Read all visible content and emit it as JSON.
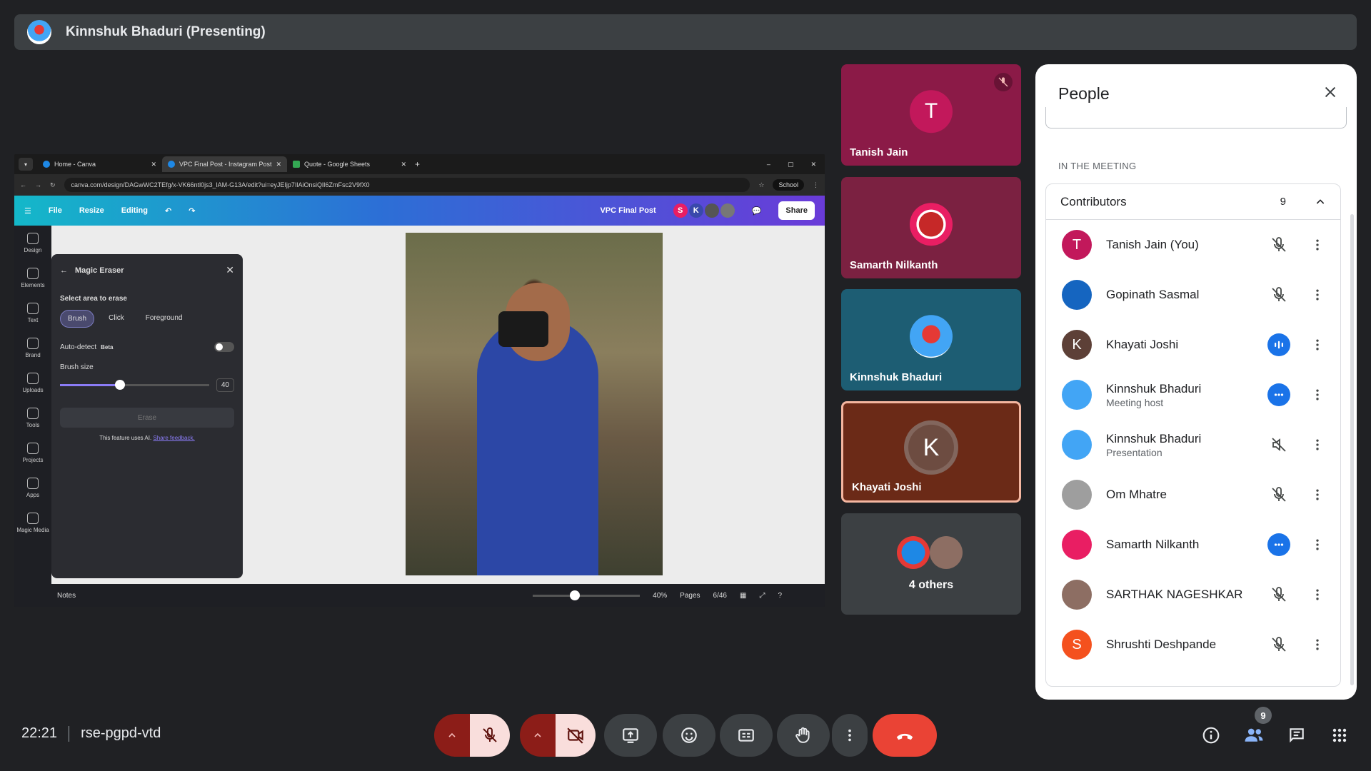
{
  "presenter_bar": {
    "title": "Kinnshuk Bhaduri (Presenting)"
  },
  "shared_screen": {
    "tabs": [
      {
        "label": "Home - Canva"
      },
      {
        "label": "VPC Final Post - Instagram Post"
      },
      {
        "label": "Quote - Google Sheets"
      }
    ],
    "url": "canva.com/design/DAGwWC2TEfg/x-VK66ntl0js3_lAM-G13A/edit?ui=eyJEIjp7IlAiOnsiQlI6ZmFsc2V9fX0",
    "profile_label": "School",
    "canva_menu": {
      "file": "File",
      "resize": "Resize",
      "editing": "Editing"
    },
    "design_title": "VPC Final Post",
    "collab_chips": [
      "S",
      "K"
    ],
    "share_label": "Share",
    "side_rail": [
      "Design",
      "Elements",
      "Text",
      "Brand",
      "Uploads",
      "Tools",
      "Projects",
      "Apps",
      "Magic Media"
    ],
    "magic_eraser": {
      "title": "Magic Eraser",
      "select_label": "Select area to erase",
      "options": [
        "Brush",
        "Click",
        "Foreground"
      ],
      "auto_detect": "Auto-detect",
      "beta": "Beta",
      "brush_size_label": "Brush size",
      "brush_size": "40",
      "brush_fraction": 0.4,
      "erase_label": "Erase",
      "note": "This feature uses AI.",
      "feedback": "Share feedback."
    },
    "bottom": {
      "notes": "Notes",
      "zoom": "40%",
      "pages": "Pages",
      "page_count": "6/46"
    }
  },
  "tiles": [
    {
      "name": "Tanish Jain",
      "initial": "T"
    },
    {
      "name": "Samarth Nilkanth"
    },
    {
      "name": "Kinnshuk Bhaduri"
    },
    {
      "name": "Khayati Joshi",
      "initial": "K"
    },
    {
      "name": "4 others"
    }
  ],
  "people_panel": {
    "title": "People",
    "section": "IN THE MEETING",
    "group_label": "Contributors",
    "group_count": "9",
    "people": [
      {
        "name": "Tanish Jain (You)",
        "initial": "T",
        "color": "#c2185b",
        "status": "muted"
      },
      {
        "name": "Gopinath Sasmal",
        "color": "#1565c0",
        "status": "muted"
      },
      {
        "name": "Khayati Joshi",
        "initial": "K",
        "color": "#5d4037",
        "status": "speaking"
      },
      {
        "name": "Kinnshuk Bhaduri",
        "sub": "Meeting host",
        "color": "#42a5f5",
        "status": "more"
      },
      {
        "name": "Kinnshuk Bhaduri",
        "sub": "Presentation",
        "color": "#42a5f5",
        "status": "audio-off"
      },
      {
        "name": "Om Mhatre",
        "color": "#9e9e9e",
        "status": "muted"
      },
      {
        "name": "Samarth Nilkanth",
        "color": "#e91e63",
        "status": "more"
      },
      {
        "name": "SARTHAK NAGESHKAR",
        "color": "#8d6e63",
        "status": "muted"
      },
      {
        "name": "Shrushti Deshpande",
        "initial": "S",
        "color": "#f4511e",
        "status": "muted"
      }
    ]
  },
  "bottom_bar": {
    "time": "22:21",
    "meeting_code": "rse-pgpd-vtd",
    "people_badge": "9"
  }
}
